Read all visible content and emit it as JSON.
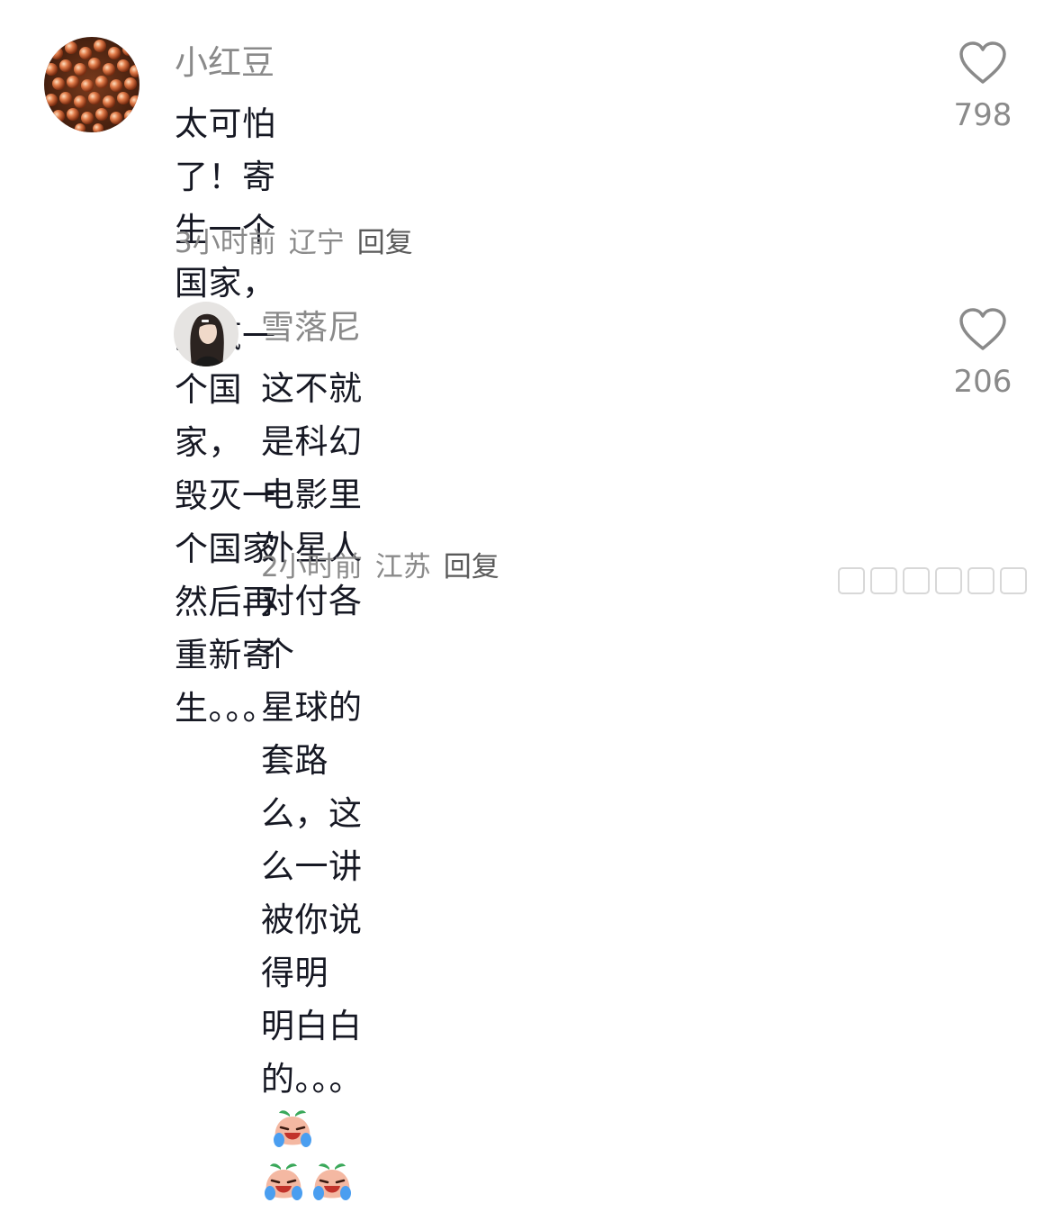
{
  "comments": [
    {
      "username": "小红豆",
      "line1": "太可怕了！寄生一个国家，搞疯一个国家，",
      "line2": "毁灭一个国家然后再重新寄生。。。",
      "time": "3小时前",
      "location": "辽宁",
      "reply_label": "回复",
      "likes": "798",
      "heart_icon": "heart-outline-icon"
    },
    {
      "username": "雪落尼",
      "line1": "这不就是科幻电影里外星人对付各个",
      "line2": "星球的套路么，这么一讲被你说得明",
      "line3": "明白白的。。。",
      "emoji_icon": "laugh-cry-peach-icon",
      "emoji_count": 3,
      "time": "2小时前",
      "location": "江苏",
      "reply_label": "回复",
      "likes": "206",
      "heart_icon": "heart-outline-icon"
    }
  ],
  "colors": {
    "text": "#161823",
    "secondary": "#8a8a8a",
    "avatar1": "#b8623a",
    "avatar2": "#d9d9d9"
  }
}
